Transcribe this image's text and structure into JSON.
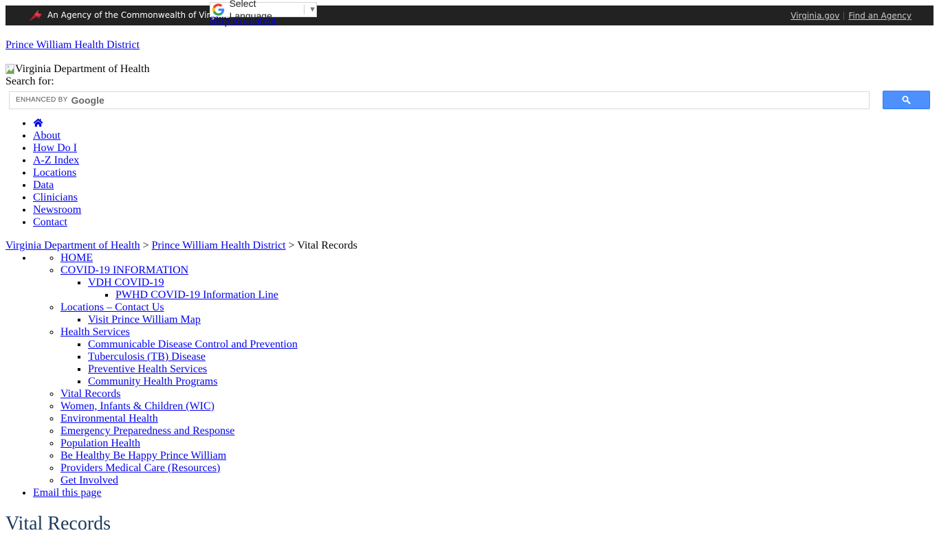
{
  "topbar": {
    "agency_text": "An Agency of the Commonwealth of Virginia",
    "links": [
      {
        "label": "Virginia.gov"
      },
      {
        "label": "Find an Agency"
      }
    ],
    "bg_color": "#222222"
  },
  "translate": {
    "label": "Select Language",
    "arrow": "▼"
  },
  "skip_link": "Skip to content",
  "site": {
    "district_link": "Prince William Health District",
    "logo_alt": "Virginia Department of Health"
  },
  "search": {
    "label": "Search for:",
    "enhanced_by": "ENHANCED BY",
    "google": "Google",
    "value": "",
    "button_color": "#4d90fe"
  },
  "nav": {
    "home_icon": "home-icon",
    "items": [
      {
        "label": "About"
      },
      {
        "label": "How Do I"
      },
      {
        "label": "A-Z Index"
      },
      {
        "label": "Locations"
      },
      {
        "label": "Data"
      },
      {
        "label": "Clinicians"
      },
      {
        "label": "Newsroom"
      },
      {
        "label": "Contact"
      }
    ]
  },
  "breadcrumb": {
    "items": [
      {
        "label": "Virginia Department of Health"
      },
      {
        "label": "Prince William Health District"
      }
    ],
    "separator": ">",
    "current": "Vital Records"
  },
  "subnav": {
    "home": "HOME",
    "covid": "COVID-19 INFORMATION",
    "vdh_covid": "VDH COVID-19",
    "pwhd_line": "PWHD COVID-19 Information Line",
    "locations": "Locations – Contact Us",
    "visit_map": "Visit Prince William Map",
    "health_services": "Health Services",
    "health_children": [
      {
        "label": "Communicable Disease Control and Prevention"
      },
      {
        "label": "Tuberculosis (TB) Disease"
      },
      {
        "label": "Preventive Health Services"
      },
      {
        "label": "Community Health Programs"
      }
    ],
    "rest": [
      {
        "label": "Vital Records"
      },
      {
        "label": "Women, Infants & Children (WIC)"
      },
      {
        "label": "Environmental Health"
      },
      {
        "label": "Emergency Preparedness and Response"
      },
      {
        "label": "Population Health"
      },
      {
        "label": "Be Healthy Be Happy Prince William"
      },
      {
        "label": "Providers Medical Care (Resources)"
      },
      {
        "label": "Get Involved"
      }
    ],
    "email": "Email this page"
  },
  "page_title": "Vital Records",
  "colors": {
    "link": "#0000ee",
    "title": "#1b3a5c"
  }
}
